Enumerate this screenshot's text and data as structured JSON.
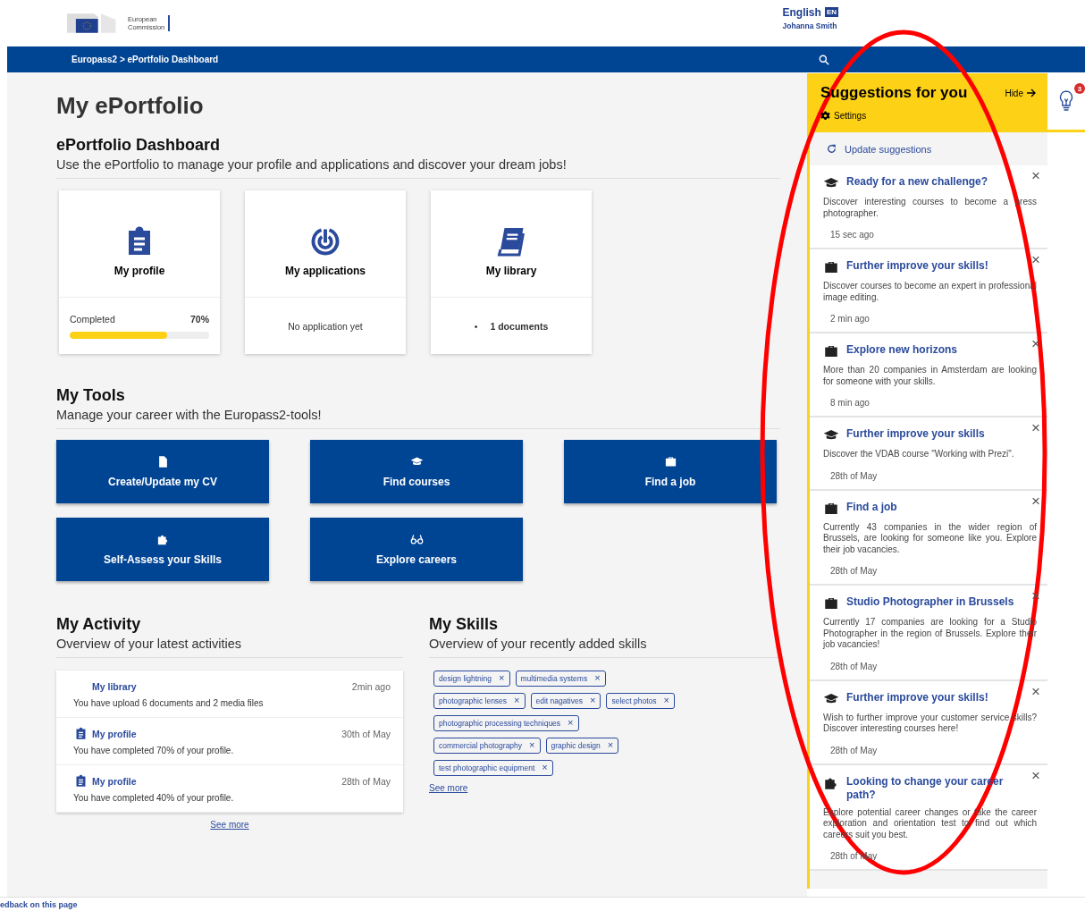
{
  "header": {
    "logo_text": [
      "European",
      "Commission"
    ],
    "language": "English",
    "language_code": "EN",
    "user": "Johanna Smith"
  },
  "breadcrumb": "Europass2 > ePortfolio Dashboard",
  "page_title": "My ePortfolio",
  "dashboard": {
    "title": "ePortfolio Dashboard",
    "subtitle": "Use the ePortfolio to manage your profile and applications and discover your dream jobs!",
    "cards": [
      {
        "kind": "profile",
        "title": "My profile",
        "label": "Completed",
        "reading": "70%",
        "level": 0.7
      },
      {
        "kind": "applications",
        "title": "My applications",
        "text": "No application yet"
      },
      {
        "kind": "library",
        "title": "My library",
        "bullet": "•",
        "text": "1 documents"
      }
    ]
  },
  "tools": {
    "title": "My Tools",
    "subtitle": "Manage your career with the Europass2-tools!",
    "buttons": [
      {
        "kind": "cv",
        "label": "Create/Update my CV"
      },
      {
        "kind": "courses",
        "label": "Find courses"
      },
      {
        "kind": "job",
        "label": "Find a job"
      },
      {
        "kind": "skills",
        "label": "Self-Assess your Skills"
      },
      {
        "kind": "careers",
        "label": "Explore careers"
      }
    ]
  },
  "activity": {
    "title": "My Activity",
    "subtitle": "Overview of your latest activities",
    "items": [
      {
        "kind": "library",
        "title": "My library",
        "time": "2min ago",
        "text": "You have upload 6 documents and 2 media files"
      },
      {
        "kind": "profile",
        "title": "My profile",
        "time": "30th of May",
        "text": "You have completed 70% of your profile."
      },
      {
        "kind": "profile",
        "title": "My profile",
        "time": "28th of May",
        "text": "You have completed 40% of your profile."
      }
    ],
    "see_more": "See more"
  },
  "skills": {
    "title": "My Skills",
    "subtitle": "Overview of your recently added skills",
    "rows": [
      [
        "design lightning",
        "multimedia systems"
      ],
      [
        "photographic lenses",
        "edit nagatives",
        "select photos"
      ],
      [
        "photographic processing techniques"
      ],
      [
        "commercial photography",
        "graphic design"
      ],
      [
        "test photographic equipment"
      ]
    ],
    "remove": "×",
    "see_more": "See more"
  },
  "suggestions": {
    "title": "Suggestions for you",
    "hide": "Hide",
    "settings": "Settings",
    "update": "Update suggestions",
    "badge": "3",
    "close": "×",
    "items": [
      {
        "kind": "course",
        "title": "Ready for a new challenge?",
        "text": "Discover interesting courses to become a press photographer.",
        "time": "15 sec ago"
      },
      {
        "kind": "job",
        "title": "Further improve your skills!",
        "text": "Discover courses to become an expert in professional image editing.",
        "time": "2 min ago"
      },
      {
        "kind": "job",
        "title": "Explore new horizons",
        "text": "More than 20 companies in Amsterdam are looking for someone with your skills.",
        "time": "8 min ago"
      },
      {
        "kind": "course",
        "title": "Further improve your skills",
        "text": "Discover the VDAB course \"Working with Prezi\".",
        "time": "28th of May"
      },
      {
        "kind": "job",
        "title": "Find a job",
        "text": "Currently 43 companies in the wider region of Brussels, are looking for someone like you. Explore their job vacancies.",
        "time": "28th of May"
      },
      {
        "kind": "job",
        "title": "Studio Photographer in Brussels",
        "text": "Currently 17 companies are looking for a Studio Photographer in the region of Brussels. Explore their job vacancies!",
        "time": "28th of May"
      },
      {
        "kind": "course",
        "title": "Further improve your skills!",
        "text": "Wish to further improve your customer service skills? Discover interesting courses here!",
        "time": "28th of May"
      },
      {
        "kind": "career",
        "title": "Looking to change your career path?",
        "text": "Explore potential career changes or take the career exploration and orientation test to find out which careers suit you best.",
        "time": "28th of May"
      }
    ]
  },
  "footer": "edback on this page"
}
